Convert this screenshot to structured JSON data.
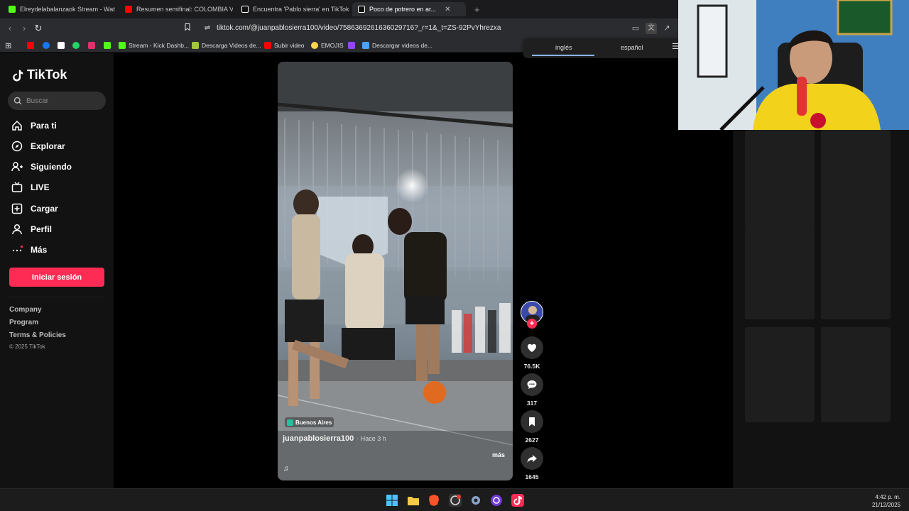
{
  "tabs": [
    {
      "label": "Elreydelabalanzaok Stream - Watch L",
      "color": "#53fc18"
    },
    {
      "label": "Resumen semifinal: COLOMBIA VS B",
      "color": "#ff0000"
    },
    {
      "label": "Encuentra 'Pablo sierra' en TikTok | B",
      "color": "#ffffff"
    },
    {
      "label": "Poco de potrero en ar...",
      "color": "#ffffff"
    }
  ],
  "new_tab": "+",
  "address": {
    "url": "tiktok.com/@juanpablosierra100/video/7586369261636029716?_r=1&_t=ZS-92PvYhrezxa"
  },
  "bookmarks": [
    {
      "label": "",
      "color": "#ff0000"
    },
    {
      "label": "",
      "color": "#1877f2"
    },
    {
      "label": "",
      "color": "#ffffff"
    },
    {
      "label": "",
      "color": "#25d366"
    },
    {
      "label": "",
      "color": "#e1306c"
    },
    {
      "label": "",
      "color": "#53fc18"
    },
    {
      "label": "Stream - Kick Dashb...",
      "color": "#53fc18"
    },
    {
      "label": "Descarga Videos de...",
      "color": "#a4c639"
    },
    {
      "label": "Subir video",
      "color": "#ff0000"
    },
    {
      "label": "EMOJIS",
      "color": "#ffd54f"
    },
    {
      "label": "",
      "color": "#9146ff"
    },
    {
      "label": "Descargar videos de...",
      "color": "#4aa3ff"
    }
  ],
  "translate": {
    "lang1": "inglés",
    "lang2": "español"
  },
  "tiktok": {
    "logo": "TikTok",
    "search_placeholder": "Buscar",
    "nav": [
      {
        "label": "Para ti",
        "icon": "home-icon"
      },
      {
        "label": "Explorar",
        "icon": "compass-icon"
      },
      {
        "label": "Siguiendo",
        "icon": "following-icon"
      },
      {
        "label": "LIVE",
        "icon": "live-icon"
      },
      {
        "label": "Cargar",
        "icon": "upload-icon"
      },
      {
        "label": "Perfil",
        "icon": "profile-icon"
      },
      {
        "label": "Más",
        "icon": "more-icon"
      }
    ],
    "login": "Iniciar sesión",
    "footer": [
      "Company",
      "Program",
      "Terms & Policies"
    ],
    "copyright": "© 2025 TikTok"
  },
  "video": {
    "location": "Buenos Aires",
    "author": "juanpablosierra100",
    "time": "· Hace 3 h",
    "more": "más",
    "likes": "76.5K",
    "comments": "317",
    "saves": "2627",
    "shares": "1645"
  },
  "clock": {
    "time": "4:42 p. m.",
    "date": "21/12/2025"
  }
}
